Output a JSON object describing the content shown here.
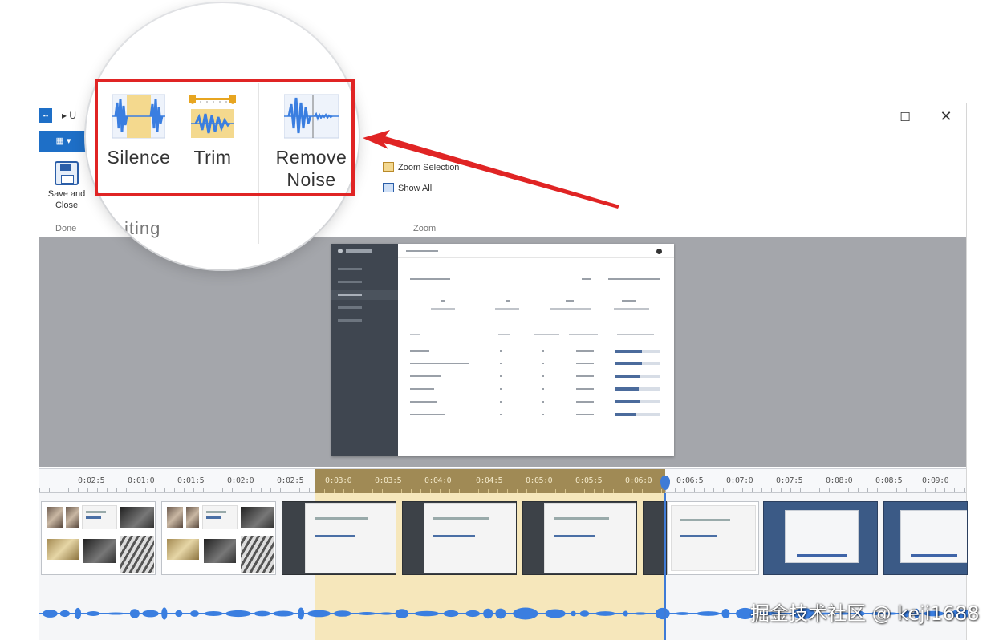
{
  "window": {
    "title": "▸ U",
    "app_icon_label": "▪▪",
    "file_tab_label": "▾"
  },
  "ribbon": {
    "save_label_line1": "Save and",
    "save_label_line2": "Close",
    "group_done": "Done",
    "zoom_items": [
      "Zoom Selection",
      "Show All"
    ],
    "group_zoom": "Zoom"
  },
  "magnified": {
    "buttons": [
      {
        "label": "Silence",
        "icon": "silence-waveform-icon"
      },
      {
        "label": "Trim",
        "icon": "trim-waveform-icon"
      },
      {
        "label_line1": "Remove",
        "label_line2": "Noise",
        "icon": "remove-noise-waveform-icon"
      }
    ],
    "group_label": "iting",
    "highlight_color": "#e02424"
  },
  "timeline": {
    "ruler_labels": [
      "0:02:5",
      "0:01:0",
      "0:01:5",
      "0:02:0",
      "0:02:5",
      "0:03:0",
      "0:03:5",
      "0:04:0",
      "0:04:5",
      "0:05:0",
      "0:05:5",
      "0:06:0",
      "0:06:5",
      "0:07:0",
      "0:07:5",
      "0:08:0",
      "0:08:5",
      "0:09:0"
    ],
    "selection_color": "#f7d77e",
    "waveform_color": "#3a7ee0",
    "playhead_color": "#3f7bd6"
  },
  "watermark": "掘金技术社区 @ keji1688"
}
